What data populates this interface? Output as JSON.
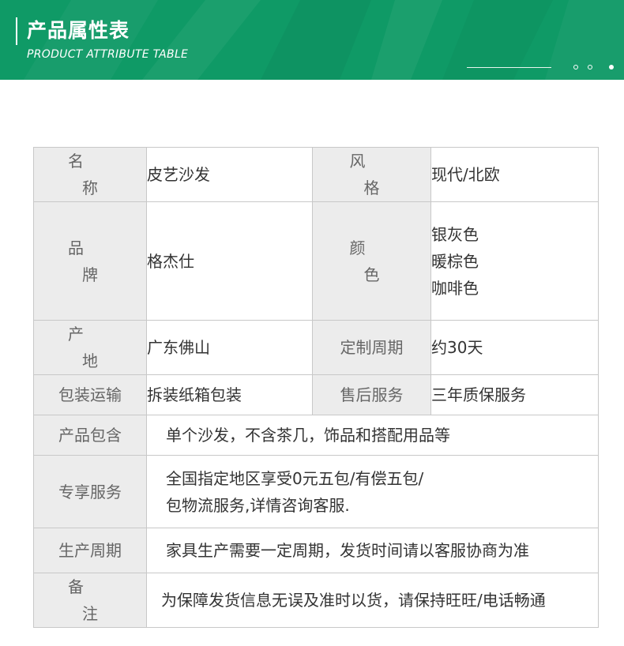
{
  "header": {
    "title": "产品属性表",
    "subtitle": "PRODUCT ATTRIBUTE TABLE"
  },
  "table": {
    "name_label": "名 称",
    "name_value": "皮艺沙发",
    "style_label": "风 格",
    "style_value": "现代/北欧",
    "brand_label": "品 牌",
    "brand_value": "格杰仕",
    "color_label": "颜 色",
    "colors": [
      "银灰色",
      "暖棕色",
      "咖啡色"
    ],
    "origin_label": "产 地",
    "origin_value": "广东佛山",
    "custom_label": "定制周期",
    "custom_value": "约30天",
    "pack_label": "包装运输",
    "pack_value": "拆装纸箱包装",
    "aftersale_label": "售后服务",
    "aftersale_value": "三年质保服务",
    "includes_label": "产品包含",
    "includes_value": "单个沙发，不含茶几，饰品和搭配用品等",
    "exclusive_label": "专享服务",
    "exclusive_lines": [
      "全国指定地区享受0元五包/有偿五包/",
      "包物流服务,详情咨询客服."
    ],
    "cycle_label": "生产周期",
    "cycle_value": "家具生产需要一定周期，发货时间请以客服协商为准",
    "remark_label": "备 注",
    "remark_value": "为保障发货信息无误及准时以货，请保持旺旺/电话畅通"
  },
  "colors": {
    "banner": "#0f9a66",
    "label_bg": "#ececec",
    "border": "#c8c8c8"
  }
}
